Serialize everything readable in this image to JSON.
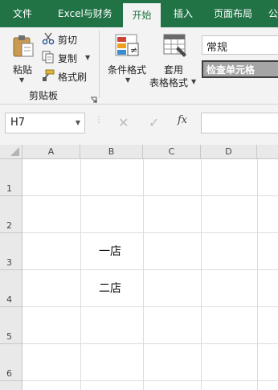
{
  "tabs": [
    "文件",
    "Excel与财务",
    "开始",
    "插入",
    "页面布局",
    "公"
  ],
  "ribbon": {
    "paste_label": "粘贴",
    "cut_label": "剪切",
    "copy_label": "复制",
    "format_painter_label": "格式刷",
    "clipboard_group": "剪贴板",
    "cond_format_label": "条件格式",
    "table_format_top": "套用",
    "table_format_bottom": "表格格式",
    "number_format_value": "常规",
    "cell_style_label": "检查单元格"
  },
  "formula_bar": {
    "name_box": "H7",
    "fx_label": "fx",
    "formula_value": ""
  },
  "grid": {
    "columns": [
      "A",
      "B",
      "C",
      "D"
    ],
    "rows": [
      "1",
      "2",
      "3",
      "4",
      "5",
      "6"
    ],
    "cells": {
      "B3": "一店",
      "B4": "二店"
    }
  },
  "colors": {
    "ribbon_green": "#217346",
    "ribbon_bg": "#f3f3f3",
    "header_bg": "#e9e9e9",
    "gridline": "#dcdcdc"
  }
}
